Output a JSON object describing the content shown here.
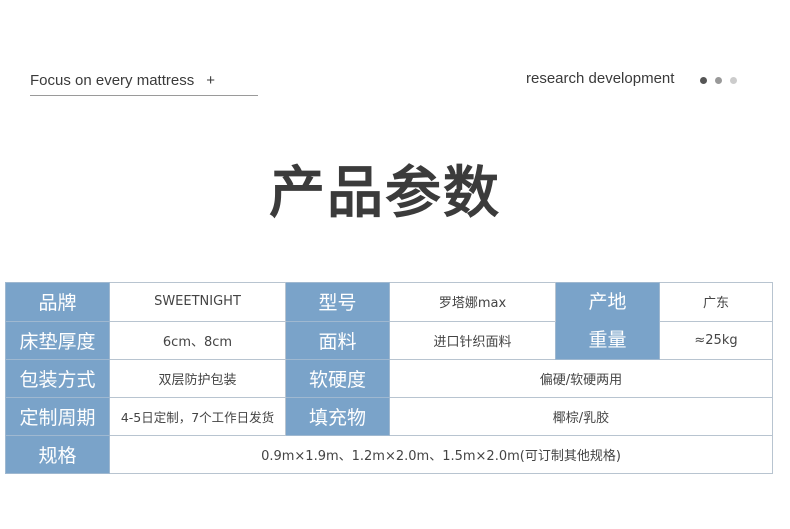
{
  "header": {
    "left_tag": "Focus on every mattress",
    "left_plus": "+",
    "right_tag": "research development",
    "dot_colors": [
      "#555555",
      "#999999",
      "#cccccc"
    ]
  },
  "title": "产品参数",
  "colors": {
    "label_bg": "#7aa3c9",
    "label_text": "#ffffff"
  },
  "params": {
    "brand": {
      "label": "品牌",
      "value": "SWEETNIGHT"
    },
    "model": {
      "label": "型号",
      "value": "罗塔娜max"
    },
    "origin": {
      "label": "产地",
      "value": "广东"
    },
    "thickness": {
      "label": "床垫厚度",
      "value": "6cm、8cm"
    },
    "fabric": {
      "label": "面料",
      "value": "进口针织面料"
    },
    "weight": {
      "label": "重量",
      "value": "≈25kg"
    },
    "packaging": {
      "label": "包装方式",
      "value": "双层防护包装"
    },
    "firmness": {
      "label": "软硬度",
      "value": "偏硬/软硬两用"
    },
    "lead_time": {
      "label": "定制周期",
      "value": "4-5日定制，7个工作日发货"
    },
    "filling": {
      "label": "填充物",
      "value": "椰棕/乳胶"
    },
    "size": {
      "label": "规格",
      "value": "0.9m×1.9m、1.2m×2.0m、1.5m×2.0m(可订制其他规格)"
    }
  }
}
